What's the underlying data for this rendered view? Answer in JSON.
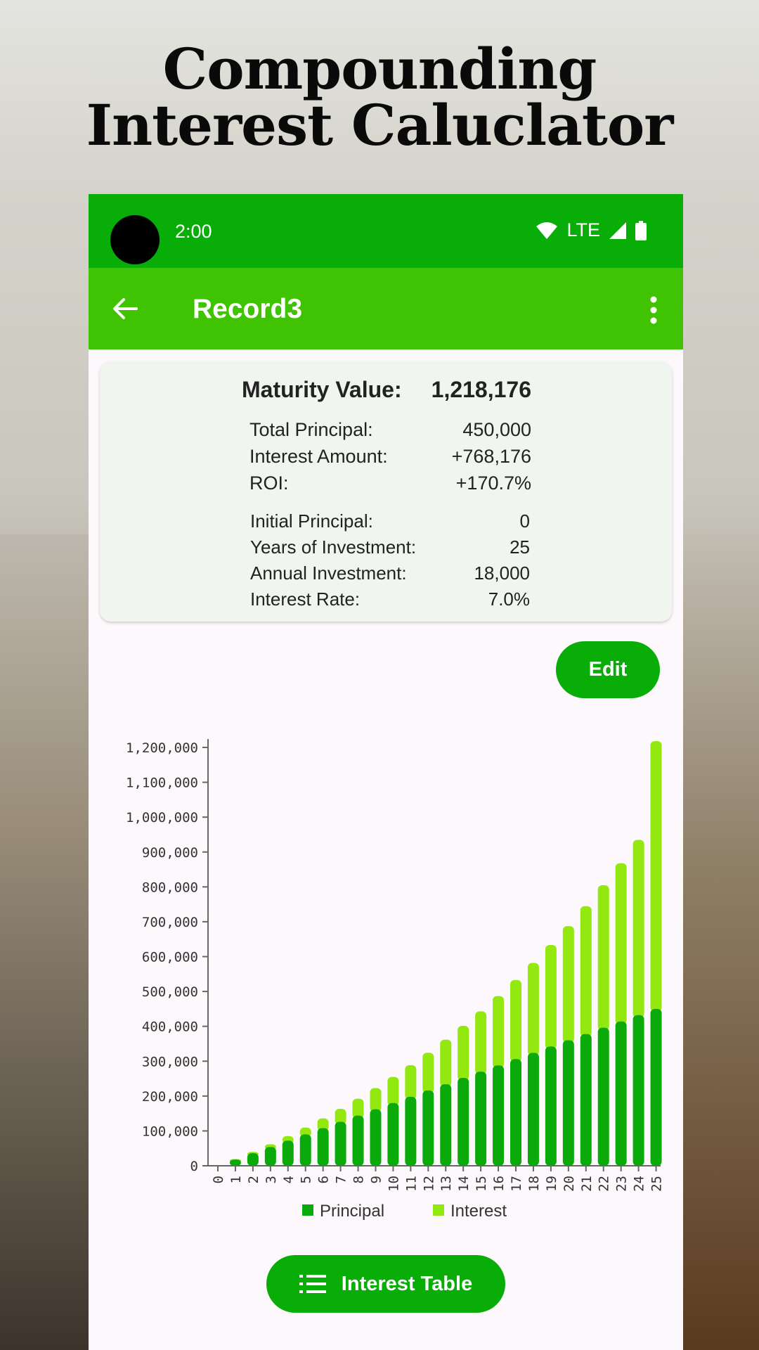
{
  "headline": {
    "line1": "Compounding",
    "line2": "Interest Caluclator"
  },
  "status_bar": {
    "time": "2:00",
    "network": "LTE",
    "icons": [
      "wifi-icon",
      "signal-icon",
      "battery-icon"
    ]
  },
  "app_bar": {
    "title": "Record3",
    "back_icon": "arrow-back-icon",
    "menu_icon": "more-vert-icon"
  },
  "summary": {
    "maturity_label": "Maturity Value:",
    "maturity_value": "1,218,176",
    "results": [
      {
        "label": "Total Principal:",
        "value": "450,000"
      },
      {
        "label": "Interest Amount:",
        "value": "+768,176"
      },
      {
        "label": "ROI:",
        "value": "+170.7%"
      }
    ],
    "inputs": [
      {
        "label": "Initial Principal:",
        "value": "0"
      },
      {
        "label": "Years of Investment:",
        "value": "25"
      },
      {
        "label": "Annual Investment:",
        "value": "18,000"
      },
      {
        "label": "Interest Rate:",
        "value": "7.0%"
      }
    ]
  },
  "edit_button": {
    "label": "Edit"
  },
  "interest_table_button": {
    "label": "Interest Table",
    "icon": "list-icon"
  },
  "colors": {
    "status_bar": "#08ad08",
    "app_bar": "#3fc303",
    "principal": "#0aaa0a",
    "interest": "#93e80f"
  },
  "chart_data": {
    "type": "bar",
    "stacked": true,
    "categories": [
      "0",
      "1",
      "2",
      "3",
      "4",
      "5",
      "6",
      "7",
      "8",
      "9",
      "10",
      "11",
      "12",
      "13",
      "14",
      "15",
      "16",
      "17",
      "18",
      "19",
      "20",
      "21",
      "22",
      "23",
      "24",
      "25"
    ],
    "series": [
      {
        "name": "Principal",
        "color": "#0aaa0a",
        "values": [
          0,
          18000,
          36000,
          54000,
          72000,
          90000,
          108000,
          126000,
          144000,
          162000,
          180000,
          198000,
          216000,
          234000,
          252000,
          270000,
          288000,
          306000,
          324000,
          342000,
          360000,
          378000,
          396000,
          414000,
          432000,
          450000
        ]
      },
      {
        "name": "Interest",
        "color": "#93e80f",
        "values": [
          0,
          1260,
          3870,
          7780,
          13110,
          19750,
          27850,
          37400,
          48400,
          60900,
          74980,
          90760,
          108300,
          127800,
          149300,
          172900,
          198800,
          227000,
          257900,
          291300,
          327500,
          366600,
          408700,
          454100,
          502900,
          768176
        ]
      }
    ],
    "ylim": [
      0,
      1200000
    ],
    "yticks": [
      0,
      100000,
      200000,
      300000,
      400000,
      500000,
      600000,
      700000,
      800000,
      900000,
      1000000,
      1100000,
      1200000
    ],
    "ytick_labels": [
      "0",
      "100,000",
      "200,000",
      "300,000",
      "400,000",
      "500,000",
      "600,000",
      "700,000",
      "800,000",
      "900,000",
      "1,000,000",
      "1,100,000",
      "1,200,000"
    ],
    "legend_position": "bottom",
    "grid": false
  }
}
